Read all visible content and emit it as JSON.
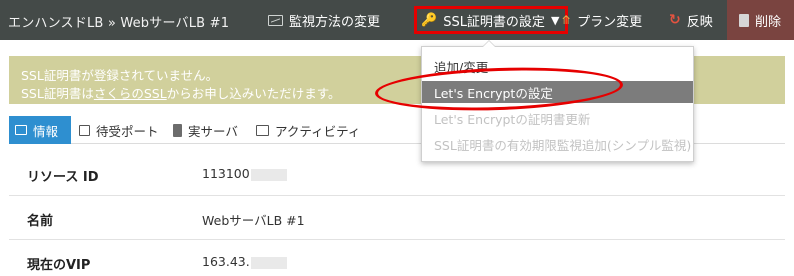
{
  "header": {
    "breadcrumb": "エンハンスドLB » WebサーバLB #1",
    "monitor_label": "監視方法の変更",
    "ssl_label": "SSL証明書の設定",
    "ssl_caret": "▼",
    "plan_label": "プラン変更",
    "reflect_label": "反映",
    "delete_label": "削除"
  },
  "alert": {
    "line1": "SSL証明書が登録されていません。",
    "line2_pre": "SSL証明書は",
    "line2_link": "さくらのSSL",
    "line2_post": "からお申し込みいただけます。",
    "bg_color": "#d1d09c"
  },
  "tabs": [
    {
      "label": "情報",
      "active": true
    },
    {
      "label": "待受ポート"
    },
    {
      "label": "実サーバ"
    },
    {
      "label": "アクティビティ"
    }
  ],
  "details": [
    {
      "label": "リソース ID",
      "value": "113100"
    },
    {
      "label": "名前",
      "value": "WebサーバLB #1"
    },
    {
      "label": "現在のVIP",
      "value": "163.43."
    }
  ],
  "ssl_menu": {
    "items": [
      {
        "label": "追加/変更",
        "enabled": true
      },
      {
        "label": "Let's Encryptの設定",
        "highlighted": true
      },
      {
        "label": "Let's Encryptの証明書更新",
        "enabled": false
      },
      {
        "label": "SSL証明書の有効期限監視追加(シンプル監視)",
        "enabled": false
      }
    ]
  },
  "icons": {
    "monitor": "monitor-chart-icon",
    "ssl": "key-icon",
    "plan": "signpost-icon",
    "reflect": "refresh-icon",
    "delete": "trash-icon"
  },
  "colors": {
    "topbar": "#444a48",
    "delete_bg": "#7a4440",
    "tab_active": "#2e8fd0",
    "annotation": "#e60000"
  }
}
